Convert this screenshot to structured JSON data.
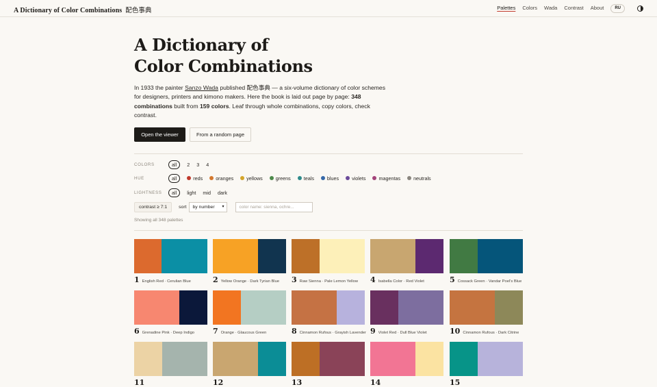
{
  "header": {
    "brand": "A Dictionary of Color Combinations",
    "brand_cjk": "配色事典",
    "nav": [
      "Palettes",
      "Colors",
      "Wada",
      "Contrast",
      "About"
    ],
    "lang": "RU"
  },
  "hero": {
    "title_line1": "A Dictionary of",
    "title_line2": "Color Combinations",
    "lead": {
      "p1": "In 1933 the painter ",
      "link": "Sanzo Wada",
      "p2": " published 配色事典 — a six-volume dictionary of color schemes for designers, printers and kimono makers. Here the book is laid out page by page: ",
      "b1": "348 combinations",
      "p3": " built from ",
      "b2": "159 colors",
      "p4": ". Leaf through whole combinations, copy colors, check contrast."
    },
    "btn_viewer": "Open the viewer",
    "btn_random": "From a random page"
  },
  "filters": {
    "colors_label": "COLORS",
    "colors": [
      "all",
      "2",
      "3",
      "4"
    ],
    "hue_label": "HUE",
    "hues": [
      {
        "label": "all",
        "color": ""
      },
      {
        "label": "reds",
        "color": "#c0392b"
      },
      {
        "label": "oranges",
        "color": "#d3782e"
      },
      {
        "label": "yellows",
        "color": "#d4a52a"
      },
      {
        "label": "greens",
        "color": "#4d8a4a"
      },
      {
        "label": "teals",
        "color": "#2e8b8b"
      },
      {
        "label": "blues",
        "color": "#3568a8"
      },
      {
        "label": "violets",
        "color": "#6b4a9a"
      },
      {
        "label": "magentas",
        "color": "#a3437a"
      },
      {
        "label": "neutrals",
        "color": "#8a867f"
      }
    ],
    "lightness_label": "LIGHTNESS",
    "lightness": [
      "all",
      "light",
      "mid",
      "dark"
    ],
    "contrast_btn": "contrast ≥ 7:1",
    "sort_label": "sort",
    "sort_value": "by number",
    "search_placeholder": "color name: sienna, ochre...",
    "showing": "Showing all 348 palettes"
  },
  "palettes": [
    {
      "num": "1",
      "name": "English Red · Cerulian Blue",
      "colors": [
        "#dc6a2e",
        "#0b8fa5"
      ],
      "split": [
        0.37
      ]
    },
    {
      "num": "2",
      "name": "Yellow Orange · Dark Tyrian Blue",
      "colors": [
        "#f7a225",
        "#11344f"
      ],
      "split": [
        0.62
      ]
    },
    {
      "num": "3",
      "name": "Raw Sienna · Pale Lemon Yellow",
      "colors": [
        "#bd7028",
        "#fdf0b9"
      ],
      "split": [
        0.38
      ]
    },
    {
      "num": "4",
      "name": "Isabella Color · Red Violet",
      "colors": [
        "#c8a670",
        "#5c2970"
      ],
      "split": [
        0.62
      ]
    },
    {
      "num": "5",
      "name": "Cossack Green · Vandar Poel's Blue",
      "colors": [
        "#417a43",
        "#05557a"
      ],
      "split": [
        0.38
      ]
    },
    {
      "num": "6",
      "name": "Grenadine Pink · Deep Indigo",
      "colors": [
        "#f78770",
        "#0b183a"
      ],
      "split": [
        0.62
      ]
    },
    {
      "num": "7",
      "name": "Orange · Glaucous Green",
      "colors": [
        "#f27521",
        "#b5cec4"
      ],
      "split": [
        0.38
      ]
    },
    {
      "num": "8",
      "name": "Cinnamon Rufous · Grayish Lavender",
      "colors": [
        "#c57244",
        "#b7b2dd"
      ],
      "split": [
        0.62
      ]
    },
    {
      "num": "9",
      "name": "Violet Red · Dull Blue Violet",
      "colors": [
        "#69305f",
        "#7d6e9f"
      ],
      "split": [
        0.38
      ]
    },
    {
      "num": "10",
      "name": "Cinnamon Rufous · Dark Citrine",
      "colors": [
        "#c57440",
        "#8d8859"
      ],
      "split": [
        0.62
      ]
    },
    {
      "num": "11",
      "name": "",
      "colors": [
        "#ecd3a5",
        "#a5b4ad"
      ],
      "split": [
        0.38
      ]
    },
    {
      "num": "12",
      "name": "",
      "colors": [
        "#c9a670",
        "#0b8d96"
      ],
      "split": [
        0.62
      ]
    },
    {
      "num": "13",
      "name": "",
      "colors": [
        "#bd6f25",
        "#8a4358"
      ],
      "split": [
        0.38
      ]
    },
    {
      "num": "14",
      "name": "",
      "colors": [
        "#f27594",
        "#fbe3a2"
      ],
      "split": [
        0.62
      ]
    },
    {
      "num": "15",
      "name": "",
      "colors": [
        "#079488",
        "#b7b3db"
      ],
      "split": [
        0.38
      ]
    }
  ]
}
